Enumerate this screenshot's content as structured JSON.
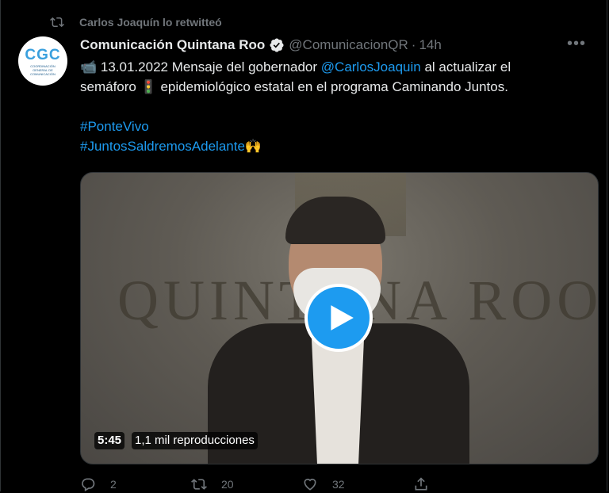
{
  "retweet": {
    "label": "Carlos Joaquín lo retwitteó",
    "icon": "retweet-icon"
  },
  "author": {
    "display_name": "Comunicación Quintana Roo",
    "handle": "@ComunicacionQR",
    "separator": "·",
    "time": "14h",
    "avatar_text": "CGC",
    "avatar_sub": "COORDINACIÓN GENERAL DE COMUNICACIÓN"
  },
  "tweet": {
    "line1_prefix": "📹 13.01.2022  Mensaje del gobernador ",
    "mention": "@CarlosJoaquin",
    "line1_suffix": " al actualizar el",
    "line2": "semáforo 🚦 epidemiológico estatal en el programa Caminando Juntos.",
    "hashtag1": "#PonteVivo",
    "hashtag2": "#JuntosSaldremosAdelante",
    "hashtag2_emoji": "🙌"
  },
  "video": {
    "wall_text": "QUINTANA ROO",
    "duration": "5:45",
    "views": "1,1 mil reproducciones"
  },
  "actions": {
    "replies": "2",
    "retweets": "20",
    "likes": "32"
  },
  "colors": {
    "accent": "#1d9bf0",
    "muted": "#71767b",
    "background": "#000000"
  }
}
